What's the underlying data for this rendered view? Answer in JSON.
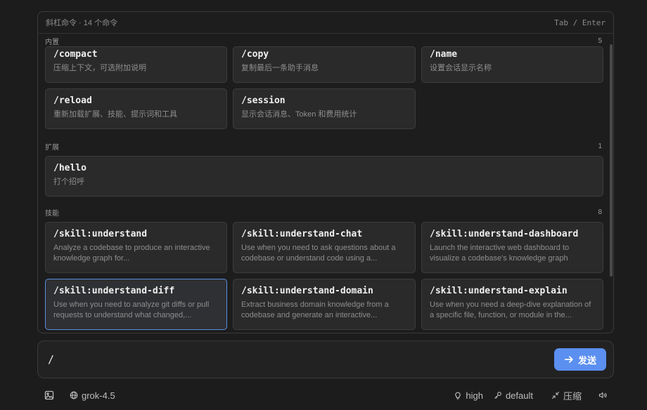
{
  "palette": {
    "title": "斜杠命令 · 14 个命令",
    "hint": "Tab / Enter",
    "sections": [
      {
        "name": "内置",
        "count": "5",
        "items": [
          {
            "cmd": "/compact",
            "desc": "压缩上下文，可选附加说明"
          },
          {
            "cmd": "/copy",
            "desc": "复制最后一条助手消息"
          },
          {
            "cmd": "/name",
            "desc": "设置会话显示名称"
          },
          {
            "cmd": "/reload",
            "desc": "重新加载扩展、技能、提示词和工具"
          },
          {
            "cmd": "/session",
            "desc": "显示会话消息、Token 和费用统计"
          }
        ]
      },
      {
        "name": "扩展",
        "count": "1",
        "items": [
          {
            "cmd": "/hello",
            "desc": "打个招呼"
          }
        ]
      },
      {
        "name": "技能",
        "count": "8",
        "items": [
          {
            "cmd": "/skill:understand",
            "desc": "Analyze a codebase to produce an interactive knowledge graph for..."
          },
          {
            "cmd": "/skill:understand-chat",
            "desc": "Use when you need to ask questions about a codebase or understand code using a..."
          },
          {
            "cmd": "/skill:understand-dashboard",
            "desc": "Launch the interactive web dashboard to visualize a codebase's knowledge graph"
          },
          {
            "cmd": "/skill:understand-diff",
            "desc": "Use when you need to analyze git diffs or pull requests to understand what changed,..."
          },
          {
            "cmd": "/skill:understand-domain",
            "desc": "Extract business domain knowledge from a codebase and generate an interactive..."
          },
          {
            "cmd": "/skill:understand-explain",
            "desc": "Use when you need a deep-dive explanation of a specific file, function, or module in the..."
          }
        ]
      }
    ]
  },
  "input": {
    "value": "/",
    "send_label": "发送"
  },
  "footer": {
    "model": "grok-4.5",
    "thinking": "high",
    "mode": "default",
    "compress": "压缩"
  }
}
